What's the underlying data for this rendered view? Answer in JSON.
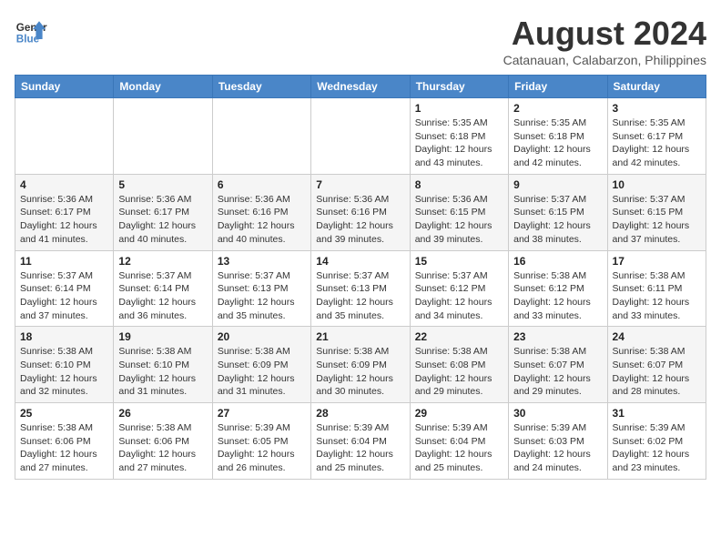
{
  "header": {
    "logo_line1": "General",
    "logo_line2": "Blue",
    "month_year": "August 2024",
    "location": "Catanauan, Calabarzon, Philippines"
  },
  "days_of_week": [
    "Sunday",
    "Monday",
    "Tuesday",
    "Wednesday",
    "Thursday",
    "Friday",
    "Saturday"
  ],
  "weeks": [
    [
      {
        "day": "",
        "info": ""
      },
      {
        "day": "",
        "info": ""
      },
      {
        "day": "",
        "info": ""
      },
      {
        "day": "",
        "info": ""
      },
      {
        "day": "1",
        "info": "Sunrise: 5:35 AM\nSunset: 6:18 PM\nDaylight: 12 hours\nand 43 minutes."
      },
      {
        "day": "2",
        "info": "Sunrise: 5:35 AM\nSunset: 6:18 PM\nDaylight: 12 hours\nand 42 minutes."
      },
      {
        "day": "3",
        "info": "Sunrise: 5:35 AM\nSunset: 6:17 PM\nDaylight: 12 hours\nand 42 minutes."
      }
    ],
    [
      {
        "day": "4",
        "info": "Sunrise: 5:36 AM\nSunset: 6:17 PM\nDaylight: 12 hours\nand 41 minutes."
      },
      {
        "day": "5",
        "info": "Sunrise: 5:36 AM\nSunset: 6:17 PM\nDaylight: 12 hours\nand 40 minutes."
      },
      {
        "day": "6",
        "info": "Sunrise: 5:36 AM\nSunset: 6:16 PM\nDaylight: 12 hours\nand 40 minutes."
      },
      {
        "day": "7",
        "info": "Sunrise: 5:36 AM\nSunset: 6:16 PM\nDaylight: 12 hours\nand 39 minutes."
      },
      {
        "day": "8",
        "info": "Sunrise: 5:36 AM\nSunset: 6:15 PM\nDaylight: 12 hours\nand 39 minutes."
      },
      {
        "day": "9",
        "info": "Sunrise: 5:37 AM\nSunset: 6:15 PM\nDaylight: 12 hours\nand 38 minutes."
      },
      {
        "day": "10",
        "info": "Sunrise: 5:37 AM\nSunset: 6:15 PM\nDaylight: 12 hours\nand 37 minutes."
      }
    ],
    [
      {
        "day": "11",
        "info": "Sunrise: 5:37 AM\nSunset: 6:14 PM\nDaylight: 12 hours\nand 37 minutes."
      },
      {
        "day": "12",
        "info": "Sunrise: 5:37 AM\nSunset: 6:14 PM\nDaylight: 12 hours\nand 36 minutes."
      },
      {
        "day": "13",
        "info": "Sunrise: 5:37 AM\nSunset: 6:13 PM\nDaylight: 12 hours\nand 35 minutes."
      },
      {
        "day": "14",
        "info": "Sunrise: 5:37 AM\nSunset: 6:13 PM\nDaylight: 12 hours\nand 35 minutes."
      },
      {
        "day": "15",
        "info": "Sunrise: 5:37 AM\nSunset: 6:12 PM\nDaylight: 12 hours\nand 34 minutes."
      },
      {
        "day": "16",
        "info": "Sunrise: 5:38 AM\nSunset: 6:12 PM\nDaylight: 12 hours\nand 33 minutes."
      },
      {
        "day": "17",
        "info": "Sunrise: 5:38 AM\nSunset: 6:11 PM\nDaylight: 12 hours\nand 33 minutes."
      }
    ],
    [
      {
        "day": "18",
        "info": "Sunrise: 5:38 AM\nSunset: 6:10 PM\nDaylight: 12 hours\nand 32 minutes."
      },
      {
        "day": "19",
        "info": "Sunrise: 5:38 AM\nSunset: 6:10 PM\nDaylight: 12 hours\nand 31 minutes."
      },
      {
        "day": "20",
        "info": "Sunrise: 5:38 AM\nSunset: 6:09 PM\nDaylight: 12 hours\nand 31 minutes."
      },
      {
        "day": "21",
        "info": "Sunrise: 5:38 AM\nSunset: 6:09 PM\nDaylight: 12 hours\nand 30 minutes."
      },
      {
        "day": "22",
        "info": "Sunrise: 5:38 AM\nSunset: 6:08 PM\nDaylight: 12 hours\nand 29 minutes."
      },
      {
        "day": "23",
        "info": "Sunrise: 5:38 AM\nSunset: 6:07 PM\nDaylight: 12 hours\nand 29 minutes."
      },
      {
        "day": "24",
        "info": "Sunrise: 5:38 AM\nSunset: 6:07 PM\nDaylight: 12 hours\nand 28 minutes."
      }
    ],
    [
      {
        "day": "25",
        "info": "Sunrise: 5:38 AM\nSunset: 6:06 PM\nDaylight: 12 hours\nand 27 minutes."
      },
      {
        "day": "26",
        "info": "Sunrise: 5:38 AM\nSunset: 6:06 PM\nDaylight: 12 hours\nand 27 minutes."
      },
      {
        "day": "27",
        "info": "Sunrise: 5:39 AM\nSunset: 6:05 PM\nDaylight: 12 hours\nand 26 minutes."
      },
      {
        "day": "28",
        "info": "Sunrise: 5:39 AM\nSunset: 6:04 PM\nDaylight: 12 hours\nand 25 minutes."
      },
      {
        "day": "29",
        "info": "Sunrise: 5:39 AM\nSunset: 6:04 PM\nDaylight: 12 hours\nand 25 minutes."
      },
      {
        "day": "30",
        "info": "Sunrise: 5:39 AM\nSunset: 6:03 PM\nDaylight: 12 hours\nand 24 minutes."
      },
      {
        "day": "31",
        "info": "Sunrise: 5:39 AM\nSunset: 6:02 PM\nDaylight: 12 hours\nand 23 minutes."
      }
    ]
  ]
}
